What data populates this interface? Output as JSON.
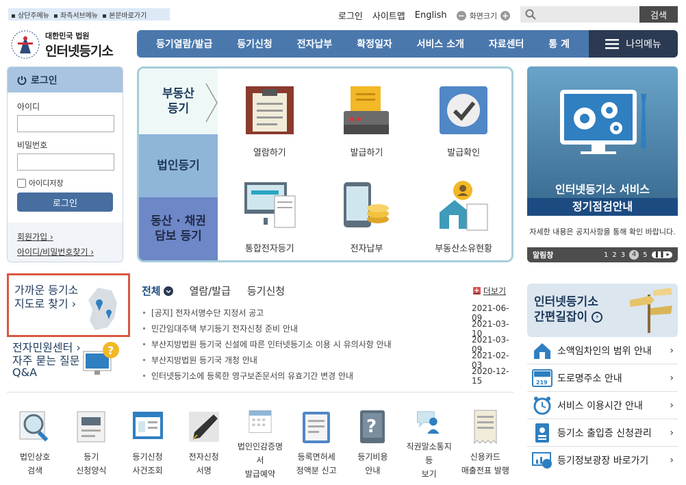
{
  "skip_links": [
    "상단주메뉴",
    "좌측서브메뉴",
    "본문바로가기"
  ],
  "util": {
    "login": "로그인",
    "sitemap": "사이트맵",
    "english": "English",
    "zoom": "화면크기"
  },
  "search": {
    "placeholder": "",
    "button": "검색"
  },
  "logo": {
    "org": "대한민국 법원",
    "name": "인터넷등기소"
  },
  "gnb": [
    "등기열람/발급",
    "등기신청",
    "전자납부",
    "확정일자",
    "서비스 소개",
    "자료센터",
    "통 계"
  ],
  "my_menu": "나의메뉴",
  "login": {
    "title": "로그인",
    "id_label": "아이디",
    "pw_label": "비밀번호",
    "remember": "아이디저장",
    "button": "로그인",
    "join": "회원가입",
    "find": "아이디/비밀번호찾기"
  },
  "center": {
    "tabs": [
      {
        "label": "부동산\n등기",
        "bg": "#eef8f7"
      },
      {
        "label": "법인등기",
        "bg": "#8fb5d9"
      },
      {
        "label": "동산 · 채권\n담보 등기",
        "bg": "#6e87c7"
      }
    ],
    "items": [
      "열람하기",
      "발급하기",
      "발급확인",
      "통합전자등기",
      "전자납부",
      "부동산소유현황"
    ]
  },
  "banner": {
    "title1": "인터넷등기소 서비스",
    "title2": "정기점검안내",
    "desc": "자세한 내용은 공지사항을 통해 확인 바랍니다.",
    "label": "알림창",
    "pages": [
      "1",
      "2",
      "3",
      "4",
      "5"
    ]
  },
  "map_box": {
    "line1": "가까운 등기소",
    "line2": "지도로 찾기"
  },
  "minwon": "전자민원센터",
  "faq": {
    "line1": "자주 묻는 질문",
    "line2": "Q&A"
  },
  "notice": {
    "tabs": [
      "전체",
      "열람/발급",
      "등기신청"
    ],
    "more": "더보기",
    "rows": [
      {
        "title": "[공지] 전자서명수단 지정서 공고",
        "date": "2021-06-09"
      },
      {
        "title": "민간임대주택 부기등기 전자신청 준비 안내",
        "date": "2021-03-10"
      },
      {
        "title": "부산지방법원 등기국 신설에 따른 인터넷등기소 이용 시 유의사항 안내",
        "date": "2021-03-09"
      },
      {
        "title": "부산지방법원 등기국 개청 안내",
        "date": "2021-02-03"
      },
      {
        "title": "인터넷등기소에 등록한 영구보존문서의 유효기간 변경 안내",
        "date": "2020-12-15"
      }
    ]
  },
  "guide": {
    "line1": "인터넷등기소",
    "line2": "간편길잡이"
  },
  "quick": [
    "소액임차인의 범위 안내",
    "도로명주소 안내",
    "서비스 이용시간 안내",
    "등기소 출입증 신청관리",
    "등기정보광장 바로가기"
  ],
  "bottom": [
    {
      "l1": "법인상호",
      "l2": "검색"
    },
    {
      "l1": "등기",
      "l2": "신청양식"
    },
    {
      "l1": "등기신청",
      "l2": "사건조회"
    },
    {
      "l1": "전자신청",
      "l2": "서명"
    },
    {
      "l1": "법인인감증명서",
      "l2": "발급예약"
    },
    {
      "l1": "등록면허세",
      "l2": "정액분 신고"
    },
    {
      "l1": "등기비용",
      "l2": "안내"
    },
    {
      "l1": "직권말소통지등",
      "l2": "보기"
    },
    {
      "l1": "신용카드",
      "l2": "매출전표 발행"
    }
  ],
  "colors": {
    "primary": "#4a78ad",
    "dark": "#2b3a52",
    "accent_red": "#d9573f"
  }
}
